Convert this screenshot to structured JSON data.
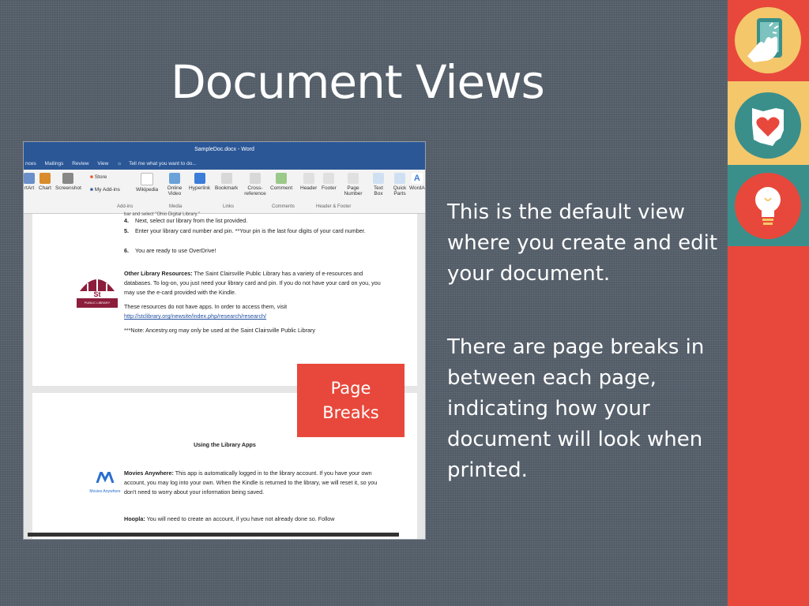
{
  "slide": {
    "title": "Document Views",
    "paragraph1": " This is the default view where you create and edit your document.",
    "paragraph2": "There are page breaks in between each page, indicating how your document will look when printed.",
    "callout_line1": "Page",
    "callout_line2": "Breaks"
  },
  "colors": {
    "background": "#56606b",
    "accent_red": "#e8483b",
    "accent_yellow": "#f4c76a",
    "accent_teal": "#3a8f8b",
    "word_blue": "#2b5797"
  },
  "sidebar_icons": [
    "tablet-touch-icon",
    "ohio-heart-icon",
    "lightbulb-icon"
  ],
  "word": {
    "window_title": "SampleDoc.docx - Word",
    "tabs": [
      "nces",
      "Mailings",
      "Review",
      "View"
    ],
    "tell_me": "Tell me what you want to do...",
    "ribbon_buttons": [
      "rtArt",
      "Chart",
      "Screenshot",
      "Wikipedia",
      "Online Video",
      "Hyperlink",
      "Bookmark",
      "Cross-reference",
      "Comment",
      "Header",
      "Footer",
      "Page Number",
      "Text Box",
      "Quick Parts",
      "WordA"
    ],
    "store": "Store",
    "my_addins": "My Add-ins",
    "groups": [
      "Add-ins",
      "Media",
      "Links",
      "Comments",
      "Header & Footer"
    ],
    "page1": {
      "cut_line": "bar and select \"Ohio Digital Library.\"",
      "steps": [
        {
          "num": "4.",
          "text": "Next, select our library from the list provided."
        },
        {
          "num": "5.",
          "text": "Enter your library card number and pin. **Your pin is the last four digits of your card number."
        },
        {
          "num": "6.",
          "text": "You are ready to use OverDrive!"
        }
      ],
      "logo_text": "St Clairsville",
      "logo_sub": "PUBLIC LIBRARY",
      "other_label": "Other Library Resources:",
      "other_text": " The Saint Clairsville Public Library has a variety of e-resources and databases. To log-on, you just need your library card and pin. If you do not have your card on you, you may use the e-card provided with the Kindle.",
      "apps_text": "These resources do not have apps. In order to access them, visit",
      "url": "http://stclibrary.org/newsite/index.php/research/research/",
      "note": "***Note: Ancestry.org may only be used at the Saint Clairsville Public Library"
    },
    "page2": {
      "heading": "Using the Library Apps",
      "ma_logo": "Movies Anywhere",
      "movies_label": "Movies Anywhere:",
      "movies_text": " This app is automatically logged in to the library account. If you have your own account, you may log into your own. When the Kindle is returned to the library, we will reset it, so you don't need to worry about your information being saved.",
      "hoopla_label": "Hoopla:",
      "hoopla_text": " You will need to create an account, if you have not already done so. Follow"
    }
  }
}
